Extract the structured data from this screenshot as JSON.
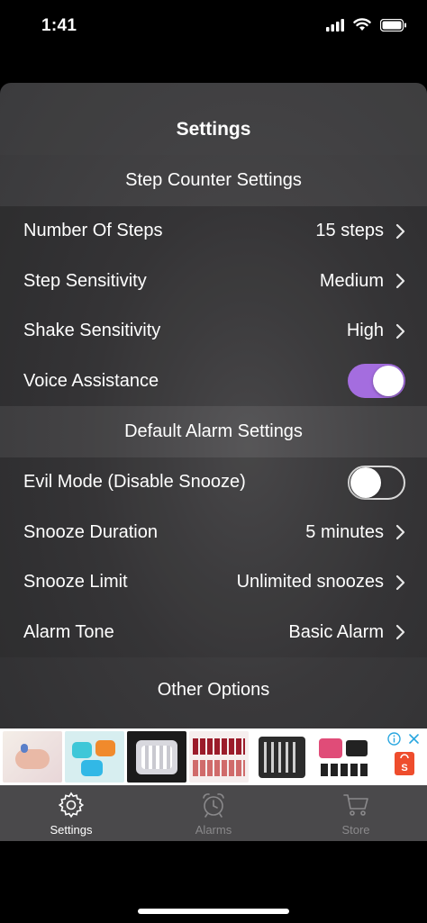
{
  "status_bar": {
    "time": "1:41"
  },
  "nav": {
    "title": "Settings"
  },
  "step_counter": {
    "header": "Step Counter Settings",
    "rows": [
      {
        "label": "Number Of Steps",
        "value": "15 steps"
      },
      {
        "label": "Step Sensitivity",
        "value": "Medium"
      },
      {
        "label": "Shake Sensitivity",
        "value": "High"
      }
    ],
    "voice_assistance": {
      "label": "Voice Assistance",
      "enabled": true
    }
  },
  "default_alarm": {
    "header": "Default Alarm Settings",
    "evil_mode": {
      "label": "Evil Mode (Disable Snooze)",
      "enabled": false
    },
    "rows": [
      {
        "label": "Snooze Duration",
        "value": "5 minutes"
      },
      {
        "label": "Snooze Limit",
        "value": "Unlimited snoozes"
      },
      {
        "label": "Alarm Tone",
        "value": "Basic Alarm"
      }
    ]
  },
  "other": {
    "header": "Other Options"
  },
  "tab_bar": {
    "tabs": [
      {
        "label": "Settings",
        "icon": "gear-icon",
        "active": true
      },
      {
        "label": "Alarms",
        "icon": "alarm-clock-icon",
        "active": false
      },
      {
        "label": "Store",
        "icon": "cart-icon",
        "active": false
      }
    ]
  },
  "colors": {
    "toggle_on": "#a46ddf",
    "tab_bar": "#4a494b",
    "ad_shop": "#ee4d2d"
  }
}
